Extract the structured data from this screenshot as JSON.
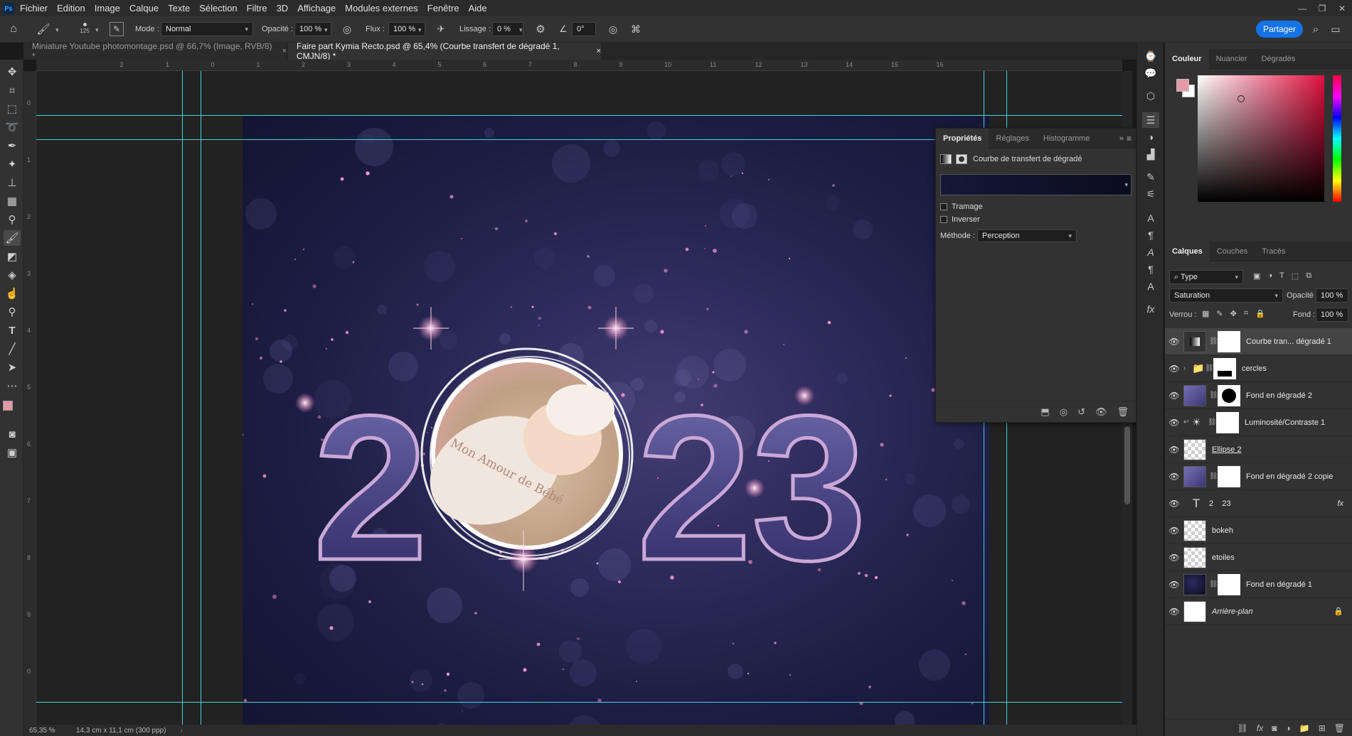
{
  "menubar": {
    "app_logo": "Ps",
    "items": [
      "Fichier",
      "Edition",
      "Image",
      "Calque",
      "Texte",
      "Sélection",
      "Filtre",
      "3D",
      "Affichage",
      "Modules externes",
      "Fenêtre",
      "Aide"
    ]
  },
  "options": {
    "brush_size": "125",
    "mode_label": "Mode :",
    "mode_value": "Normal",
    "opacity_label": "Opacité :",
    "opacity_value": "100 %",
    "flow_label": "Flux :",
    "flow_value": "100 %",
    "smoothing_label": "Lissage :",
    "smoothing_value": "0 %",
    "angle_value": "0°",
    "share_label": "Partager"
  },
  "tabs": [
    {
      "label": "Miniature Youtube photomontage.psd @ 66,7% (Image, RVB/8) *",
      "close": "×"
    },
    {
      "label": "Faire part Kymia Recto.psd @ 65,4% (Courbe transfert de dégradé 1, CMJN/8) *",
      "close": "×"
    }
  ],
  "ruler_h": [
    "2",
    "1",
    "0",
    "1",
    "2",
    "3",
    "4",
    "5",
    "6",
    "7",
    "8",
    "9",
    "10",
    "11",
    "12",
    "13",
    "14",
    "15",
    "16"
  ],
  "ruler_v": [
    "0",
    "1",
    "2",
    "3",
    "4",
    "5",
    "6",
    "7",
    "8",
    "9",
    "0"
  ],
  "artwork": {
    "digit_left": "2",
    "digits_right": "23",
    "photo_caption": "Mon Amour de Bébé",
    "colors": {
      "digit_fill": "#4f4a86",
      "digit_rim": "#c9a8d8",
      "glow": "#ff9ad2"
    }
  },
  "properties": {
    "tabs": [
      "Propriétés",
      "Réglages",
      "Histogramme"
    ],
    "title": "Courbe de transfert de dégradé",
    "tramage": "Tramage",
    "inverser": "Inverser",
    "method_label": "Méthode :",
    "method_value": "Perception"
  },
  "color_panel": {
    "tabs": [
      "Couleur",
      "Nuancier",
      "Dégradés"
    ],
    "fg_color": "#e39aa6",
    "bg_color": "#ffffff"
  },
  "layers_panel": {
    "tabs": [
      "Calques",
      "Couches",
      "Tracés"
    ],
    "filter_label": "Type",
    "blend_mode": "Saturation",
    "opacity_label": "Opacité :",
    "opacity_value": "100 %",
    "lock_label": "Verrou :",
    "fill_label": "Fond :",
    "fill_value": "100 %",
    "layers": [
      {
        "name": "Courbe tran... dégradé 1",
        "selected": true
      },
      {
        "name": "cercles"
      },
      {
        "name": "Fond en dégradé 2"
      },
      {
        "name": "Luminosité/Contraste 1"
      },
      {
        "name": "Ellipse 2"
      },
      {
        "name": "Fond en dégradé 2 copie"
      },
      {
        "name": "2    23",
        "fx": "fx"
      },
      {
        "name": "bokeh"
      },
      {
        "name": "etoiles"
      },
      {
        "name": "Fond en dégradé 1"
      },
      {
        "name": "Arrière-plan"
      }
    ]
  },
  "status": {
    "zoom": "65,35 %",
    "doc_info": "14,3 cm x 11,1 cm (300 ppp)"
  }
}
